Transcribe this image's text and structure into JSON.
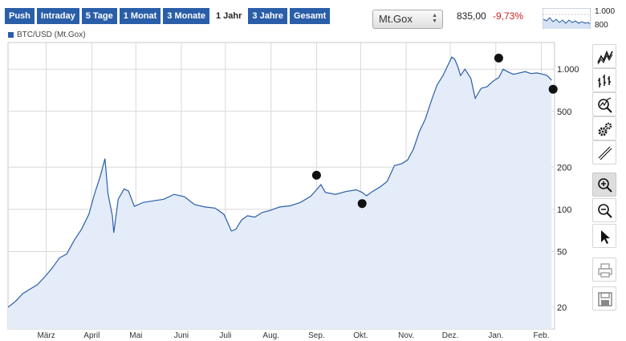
{
  "tabs": [
    {
      "label": "Push",
      "active": false
    },
    {
      "label": "Intraday",
      "active": false
    },
    {
      "label": "5 Tage",
      "active": false
    },
    {
      "label": "1 Monat",
      "active": false
    },
    {
      "label": "3 Monate",
      "active": false
    },
    {
      "label": "1 Jahr",
      "active": true
    },
    {
      "label": "3 Jahre",
      "active": false
    },
    {
      "label": "Gesamt",
      "active": false
    }
  ],
  "source_select": {
    "value": "Mt.Gox"
  },
  "quote": {
    "price": "835,00",
    "change": "-9,73%"
  },
  "mini_chart": {
    "high_label": "1.000",
    "low_label": "800"
  },
  "legend": {
    "label": "BTC/USD (Mt.Gox)"
  },
  "colors": {
    "accent": "#2a5ea8",
    "line": "#2a5ea8",
    "area": "#e4ecf9",
    "negative": "#d42020",
    "grid": "#d8d8d8"
  },
  "toolbar": [
    "line-chart-icon",
    "ohlc-chart-icon",
    "indicators-icon",
    "settings-icon",
    "draw-line-icon",
    "zoom-in-icon",
    "zoom-out-icon",
    "pointer-icon",
    "print-icon",
    "save-icon"
  ],
  "chart_data": {
    "type": "area",
    "title": "",
    "xlabel": "",
    "ylabel": "",
    "series_name": "BTC/USD (Mt.Gox)",
    "y_scale": "log",
    "ylim": [
      14,
      1550
    ],
    "xlim": [
      "2013-02-03",
      "2014-02-10"
    ],
    "y_ticks": [
      {
        "value": 20,
        "label": "20"
      },
      {
        "value": 50,
        "label": "50"
      },
      {
        "value": 100,
        "label": "100"
      },
      {
        "value": 200,
        "label": "200"
      },
      {
        "value": 500,
        "label": "500"
      },
      {
        "value": 1000,
        "label": "1.000"
      }
    ],
    "x_ticks": [
      {
        "date": "2013-03-01",
        "label": "März"
      },
      {
        "date": "2013-04-01",
        "label": "April"
      },
      {
        "date": "2013-05-01",
        "label": "Mai"
      },
      {
        "date": "2013-06-01",
        "label": "Juni"
      },
      {
        "date": "2013-07-01",
        "label": "Juli"
      },
      {
        "date": "2013-08-01",
        "label": "Aug."
      },
      {
        "date": "2013-09-01",
        "label": "Sep."
      },
      {
        "date": "2013-10-01",
        "label": "Okt."
      },
      {
        "date": "2013-11-01",
        "label": "Nov."
      },
      {
        "date": "2013-12-01",
        "label": "Dez."
      },
      {
        "date": "2014-01-01",
        "label": "Jan."
      },
      {
        "date": "2014-02-01",
        "label": "Feb."
      }
    ],
    "points": [
      [
        "2013-02-03",
        20
      ],
      [
        "2013-02-08",
        22
      ],
      [
        "2013-02-13",
        25
      ],
      [
        "2013-02-18",
        27
      ],
      [
        "2013-02-23",
        29
      ],
      [
        "2013-02-28",
        33
      ],
      [
        "2013-03-05",
        38
      ],
      [
        "2013-03-10",
        45
      ],
      [
        "2013-03-15",
        48
      ],
      [
        "2013-03-20",
        60
      ],
      [
        "2013-03-25",
        72
      ],
      [
        "2013-03-30",
        92
      ],
      [
        "2013-04-03",
        130
      ],
      [
        "2013-04-07",
        175
      ],
      [
        "2013-04-10",
        230
      ],
      [
        "2013-04-12",
        130
      ],
      [
        "2013-04-15",
        90
      ],
      [
        "2013-04-16",
        68
      ],
      [
        "2013-04-19",
        118
      ],
      [
        "2013-04-23",
        140
      ],
      [
        "2013-04-26",
        135
      ],
      [
        "2013-04-30",
        105
      ],
      [
        "2013-05-06",
        112
      ],
      [
        "2013-05-13",
        115
      ],
      [
        "2013-05-20",
        118
      ],
      [
        "2013-05-27",
        128
      ],
      [
        "2013-06-03",
        123
      ],
      [
        "2013-06-10",
        108
      ],
      [
        "2013-06-17",
        104
      ],
      [
        "2013-06-24",
        102
      ],
      [
        "2013-06-30",
        92
      ],
      [
        "2013-07-05",
        70
      ],
      [
        "2013-07-08",
        72
      ],
      [
        "2013-07-12",
        84
      ],
      [
        "2013-07-16",
        90
      ],
      [
        "2013-07-21",
        88
      ],
      [
        "2013-07-26",
        95
      ],
      [
        "2013-07-31",
        98
      ],
      [
        "2013-08-07",
        104
      ],
      [
        "2013-08-14",
        106
      ],
      [
        "2013-08-21",
        112
      ],
      [
        "2013-08-28",
        124
      ],
      [
        "2013-09-01",
        138
      ],
      [
        "2013-09-04",
        150
      ],
      [
        "2013-09-07",
        132
      ],
      [
        "2013-09-14",
        128
      ],
      [
        "2013-09-21",
        134
      ],
      [
        "2013-09-28",
        138
      ],
      [
        "2013-10-02",
        132
      ],
      [
        "2013-10-05",
        125
      ],
      [
        "2013-10-09",
        134
      ],
      [
        "2013-10-14",
        144
      ],
      [
        "2013-10-19",
        158
      ],
      [
        "2013-10-24",
        205
      ],
      [
        "2013-10-29",
        212
      ],
      [
        "2013-11-02",
        225
      ],
      [
        "2013-11-06",
        270
      ],
      [
        "2013-11-10",
        360
      ],
      [
        "2013-11-14",
        440
      ],
      [
        "2013-11-18",
        590
      ],
      [
        "2013-11-22",
        770
      ],
      [
        "2013-11-26",
        900
      ],
      [
        "2013-11-30",
        1100
      ],
      [
        "2013-12-02",
        1220
      ],
      [
        "2013-12-04",
        1180
      ],
      [
        "2013-12-06",
        1050
      ],
      [
        "2013-12-08",
        900
      ],
      [
        "2013-12-11",
        1000
      ],
      [
        "2013-12-15",
        860
      ],
      [
        "2013-12-18",
        620
      ],
      [
        "2013-12-22",
        730
      ],
      [
        "2013-12-26",
        750
      ],
      [
        "2013-12-30",
        820
      ],
      [
        "2014-01-03",
        870
      ],
      [
        "2014-01-06",
        1000
      ],
      [
        "2014-01-09",
        960
      ],
      [
        "2014-01-13",
        920
      ],
      [
        "2014-01-17",
        940
      ],
      [
        "2014-01-21",
        960
      ],
      [
        "2014-01-25",
        930
      ],
      [
        "2014-01-29",
        940
      ],
      [
        "2014-02-02",
        920
      ],
      [
        "2014-02-05",
        900
      ],
      [
        "2014-02-08",
        835
      ]
    ],
    "markers": [
      {
        "date": "2013-09-01",
        "value": 175
      },
      {
        "date": "2013-10-02",
        "value": 110
      },
      {
        "date": "2014-01-03",
        "value": 1200
      },
      {
        "date": "2014-02-09",
        "value": 720
      }
    ]
  }
}
